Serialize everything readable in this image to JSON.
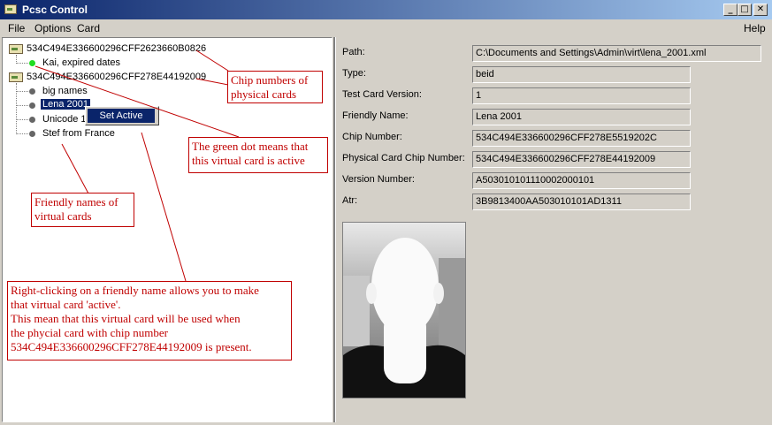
{
  "window": {
    "title": "Pcsc Control",
    "min": "_",
    "max": "□",
    "close": "✕"
  },
  "menu": {
    "file": "File",
    "options": "Options",
    "card": "Card",
    "help": "Help"
  },
  "tree": {
    "card1": {
      "chip": "534C494E336600296CFF2623660B0826",
      "child": "Kai, expired dates"
    },
    "card2": {
      "chip": "534C494E336600296CFF278E44192009",
      "children": [
        "big names",
        "Lena 2001",
        "Unicode 1",
        "Stef from France"
      ]
    }
  },
  "context_menu": {
    "item": "Set Active"
  },
  "annotations": {
    "chip_numbers": "Chip numbers of\nphysical cards",
    "green_dot": "The green dot means that\nthis virtual card is active",
    "friendly_names": "Friendly names of\nvirtual cards",
    "right_click": "Right-clicking on a friendly name allows you to make\nthat virtual card 'active'.\nThis mean that this virtual card will be used when\nthe phycial card with chip number\n534C494E336600296CFF278E44192009 is present."
  },
  "details": {
    "path_label": "Path:",
    "path": "C:\\Documents and Settings\\Admin\\virt\\lena_2001.xml",
    "type_label": "Type:",
    "type": "beid",
    "test_label": "Test Card Version:",
    "test": "1",
    "friendly_label": "Friendly Name:",
    "friendly": "Lena 2001",
    "chip_label": "Chip Number:",
    "chip": "534C494E336600296CFF278E5519202C",
    "phys_label": "Physical Card Chip Number:",
    "phys": "534C494E336600296CFF278E44192009",
    "version_label": "Version Number:",
    "version": "A503010101110002000101",
    "atr_label": "Atr:",
    "atr": "3B9813400AA503010101AD1311"
  },
  "colors": {
    "titlebar": "#0a246a",
    "annotation": "#c00000",
    "active_dot": "#22dd22",
    "selection": "#0a246a"
  }
}
